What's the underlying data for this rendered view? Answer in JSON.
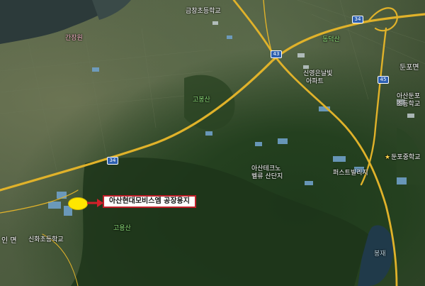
{
  "annotation": {
    "callout_text": "아산현대모비스엠 공장용지",
    "marker_color": "#ffe600",
    "arrow_color": "#d4202a",
    "border_color": "#c0202a"
  },
  "labels": {
    "top_school": "금창초등학교",
    "tl_pink": "간장원",
    "gobongsan": "고봉산",
    "dongdeoksan": "동덕산",
    "apartment_1": "신영은날빛",
    "apartment_2": "아파트",
    "dopo_myeon": "둔포면",
    "dunpo_school_1": "아산둔포",
    "dunpo_school_2": "초등학교",
    "middle_school": "둔포중학교",
    "business_park_1": "아산테크노",
    "business_park_2": "벨류 산단지",
    "fasttech": "퍼스트빌리지",
    "goyongsan": "고용산",
    "left_myeon": "인 면",
    "sinchang_school": "신화초등학교",
    "bongjae": "봉재",
    "star_icon": "star-icon"
  },
  "highways": {
    "route_34_a": "34",
    "route_34_b": "34",
    "route_43": "43",
    "route_45": "45"
  }
}
